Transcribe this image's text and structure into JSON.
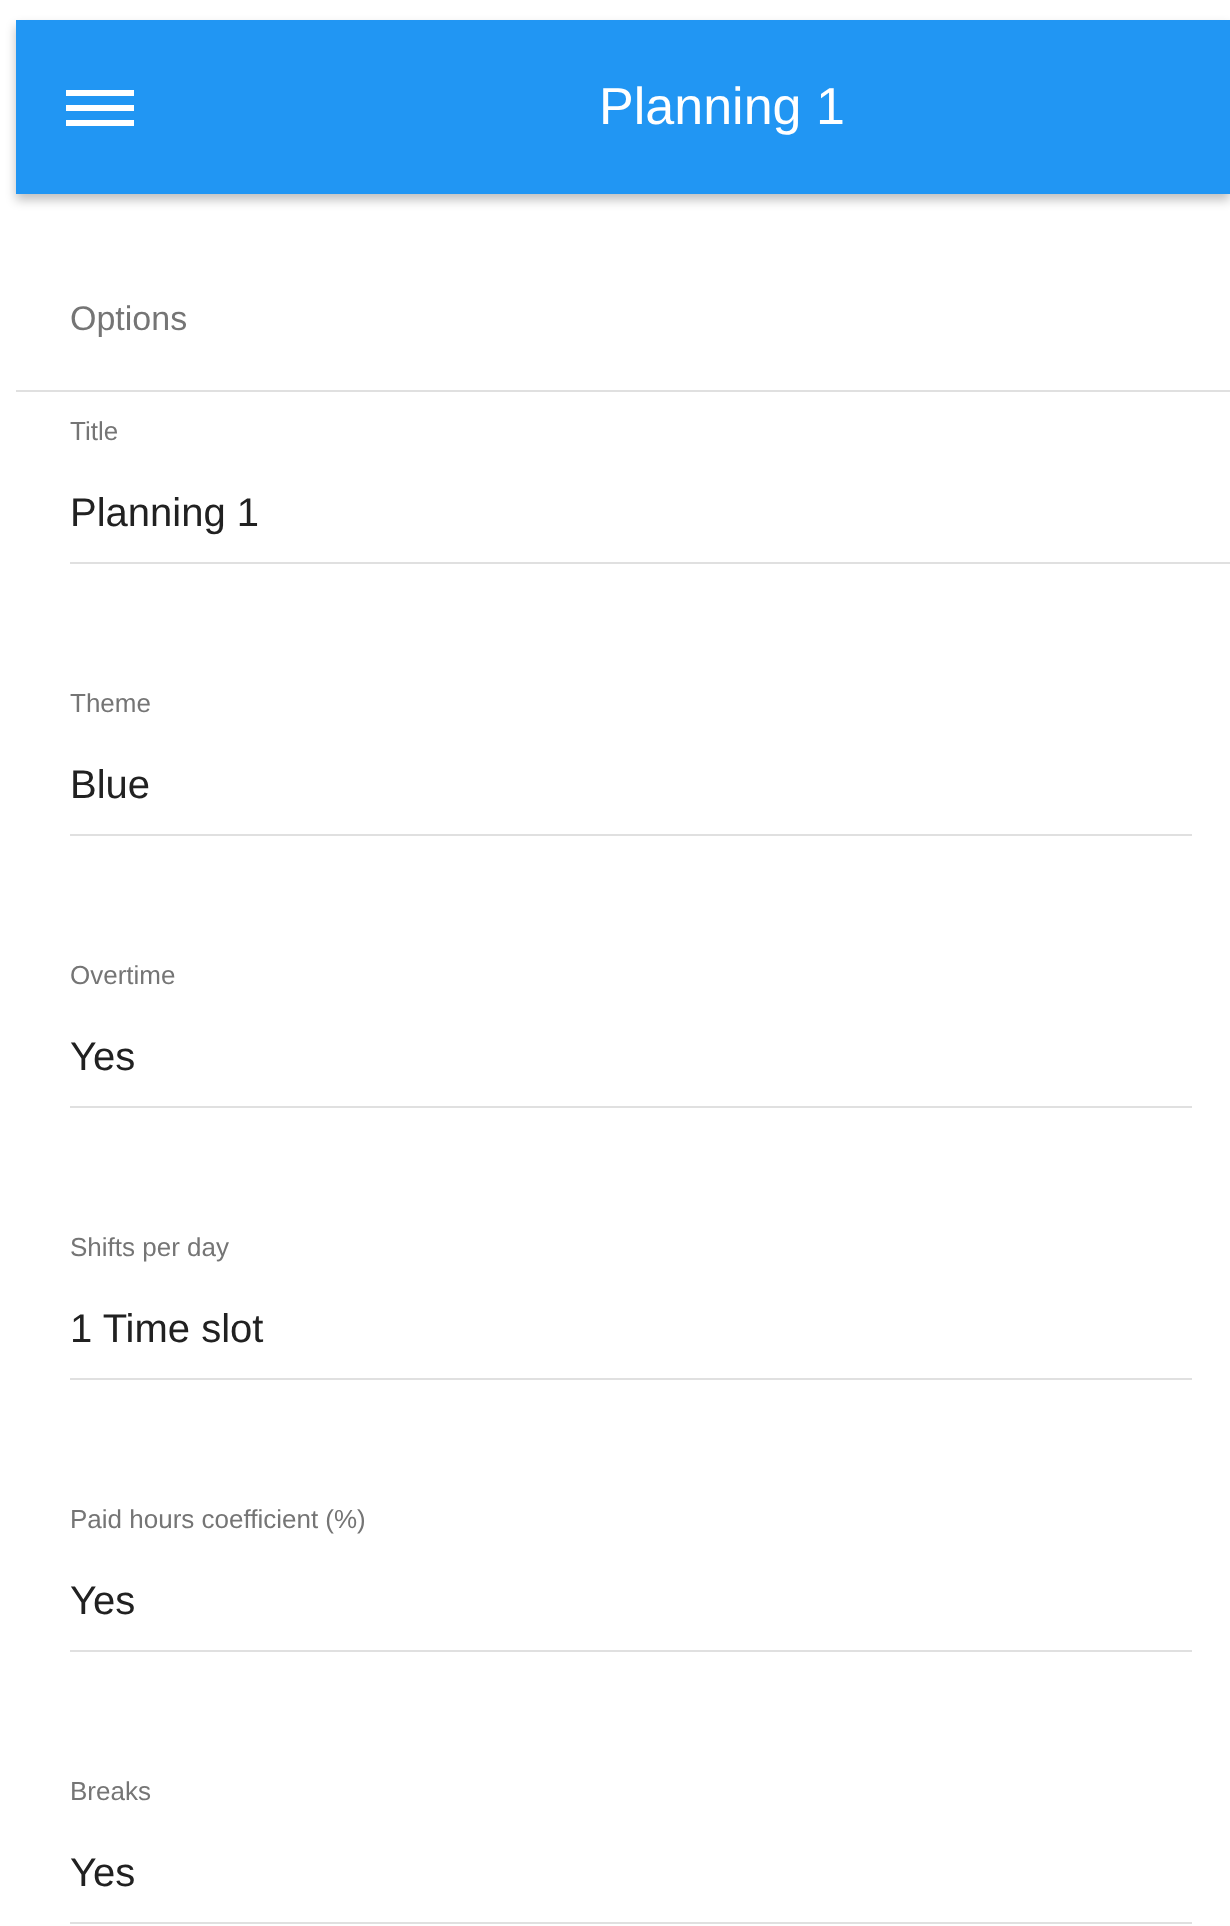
{
  "app_bar": {
    "title": "Planning 1"
  },
  "section": {
    "title": "Options"
  },
  "fields": [
    {
      "kind": "input",
      "label": "Title",
      "value": "Planning 1"
    },
    {
      "kind": "select",
      "label": "Theme",
      "value": "Blue"
    },
    {
      "kind": "select",
      "label": "Overtime",
      "value": "Yes"
    },
    {
      "kind": "select",
      "label": "Shifts per day",
      "value": "1 Time slot"
    },
    {
      "kind": "select",
      "label": "Paid hours coefficient (%)",
      "value": "Yes"
    },
    {
      "kind": "select",
      "label": "Breaks",
      "value": "Yes"
    }
  ]
}
